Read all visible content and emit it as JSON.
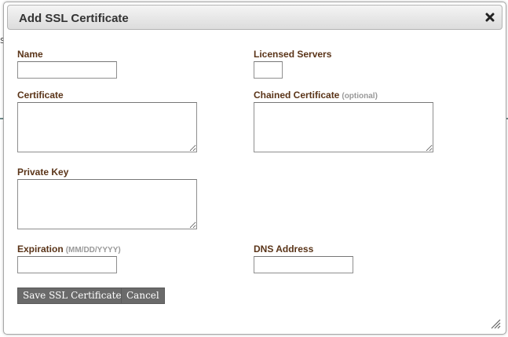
{
  "dialog": {
    "title": "Add SSL Certificate",
    "close_icon": "close-icon"
  },
  "background": {
    "stub_text": "s"
  },
  "form": {
    "name": {
      "label": "Name",
      "value": ""
    },
    "licensed_servers": {
      "label": "Licensed Servers",
      "value": ""
    },
    "certificate": {
      "label": "Certificate",
      "value": ""
    },
    "chained_certificate": {
      "label": "Chained Certificate",
      "hint": "(optional)",
      "value": ""
    },
    "private_key": {
      "label": "Private Key",
      "value": ""
    },
    "expiration": {
      "label": "Expiration",
      "hint": "(MM/DD/YYYY)",
      "value": ""
    },
    "dns_address": {
      "label": "DNS Address",
      "value": ""
    }
  },
  "buttons": {
    "save_label": "Save SSL Certificate",
    "cancel_label": "Cancel"
  },
  "colors": {
    "label": "#5a3418",
    "hint": "#999999",
    "button_bg": "#6a6a6a",
    "button_text": "#ffffff"
  }
}
